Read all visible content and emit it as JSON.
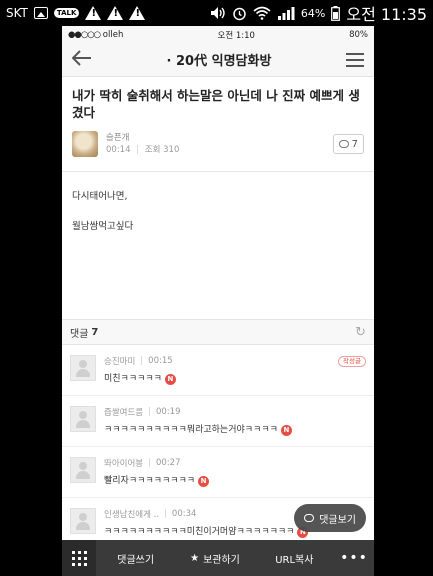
{
  "os_status": {
    "carrier": "SKT",
    "talk_label": "TALK",
    "battery": "64%",
    "time": "오전 11:35"
  },
  "ios_status": {
    "signal": "●●○○○",
    "carrier": "olleh",
    "time": "오전 1:10",
    "battery": "80%"
  },
  "nav": {
    "back_icon": "arrow-left-icon",
    "title": "· 20代 익명담화방",
    "menu_icon": "hamburger-icon"
  },
  "post": {
    "title": "내가 딱히 술취해서 하는말은 아닌데 나 진짜 예쁘게 생겼다",
    "author": "슬픈개",
    "time": "00:14",
    "views": "조회 310",
    "comment_count": "7",
    "body_lines": [
      "다시태어나면,",
      "월남쌈먹고싶다"
    ]
  },
  "comments_header": {
    "label": "댓글",
    "count": "7"
  },
  "comments": [
    {
      "author": "승진마미",
      "time": "00:15",
      "text": "미친ㅋㅋㅋㅋㅋ",
      "new": "N",
      "badge": "작성글"
    },
    {
      "author": "즙쌀여드름",
      "time": "00:19",
      "text": "ㅋㅋㅋㅋㅋㅋㅋㅋㅋㅋ뭐라고하는거야ㅋㅋㅋㅋ",
      "new": "N"
    },
    {
      "author": "똬아이어봉",
      "time": "00:27",
      "text": "빨리자ㅋㅋㅋㅋㅋㅋㅋㅋ",
      "new": "N"
    },
    {
      "author": "인생남친에게 ..",
      "time": "00:34",
      "text": "ㅋㅋㅋㅋㅋㅋㅋㅋㅋㅋ미친이거머얌ㅋㅋㅋㅋㅋㅋㅋ",
      "new": "N"
    }
  ],
  "float_button": {
    "label": "댓글보기"
  },
  "toolbar": {
    "write": "댓글쓰기",
    "bookmark": "보관하기",
    "url_copy": "URL복사",
    "more": "•••"
  },
  "colors": {
    "accent_red": "#e64d45",
    "toolbar_bg": "#3a3a3a"
  }
}
